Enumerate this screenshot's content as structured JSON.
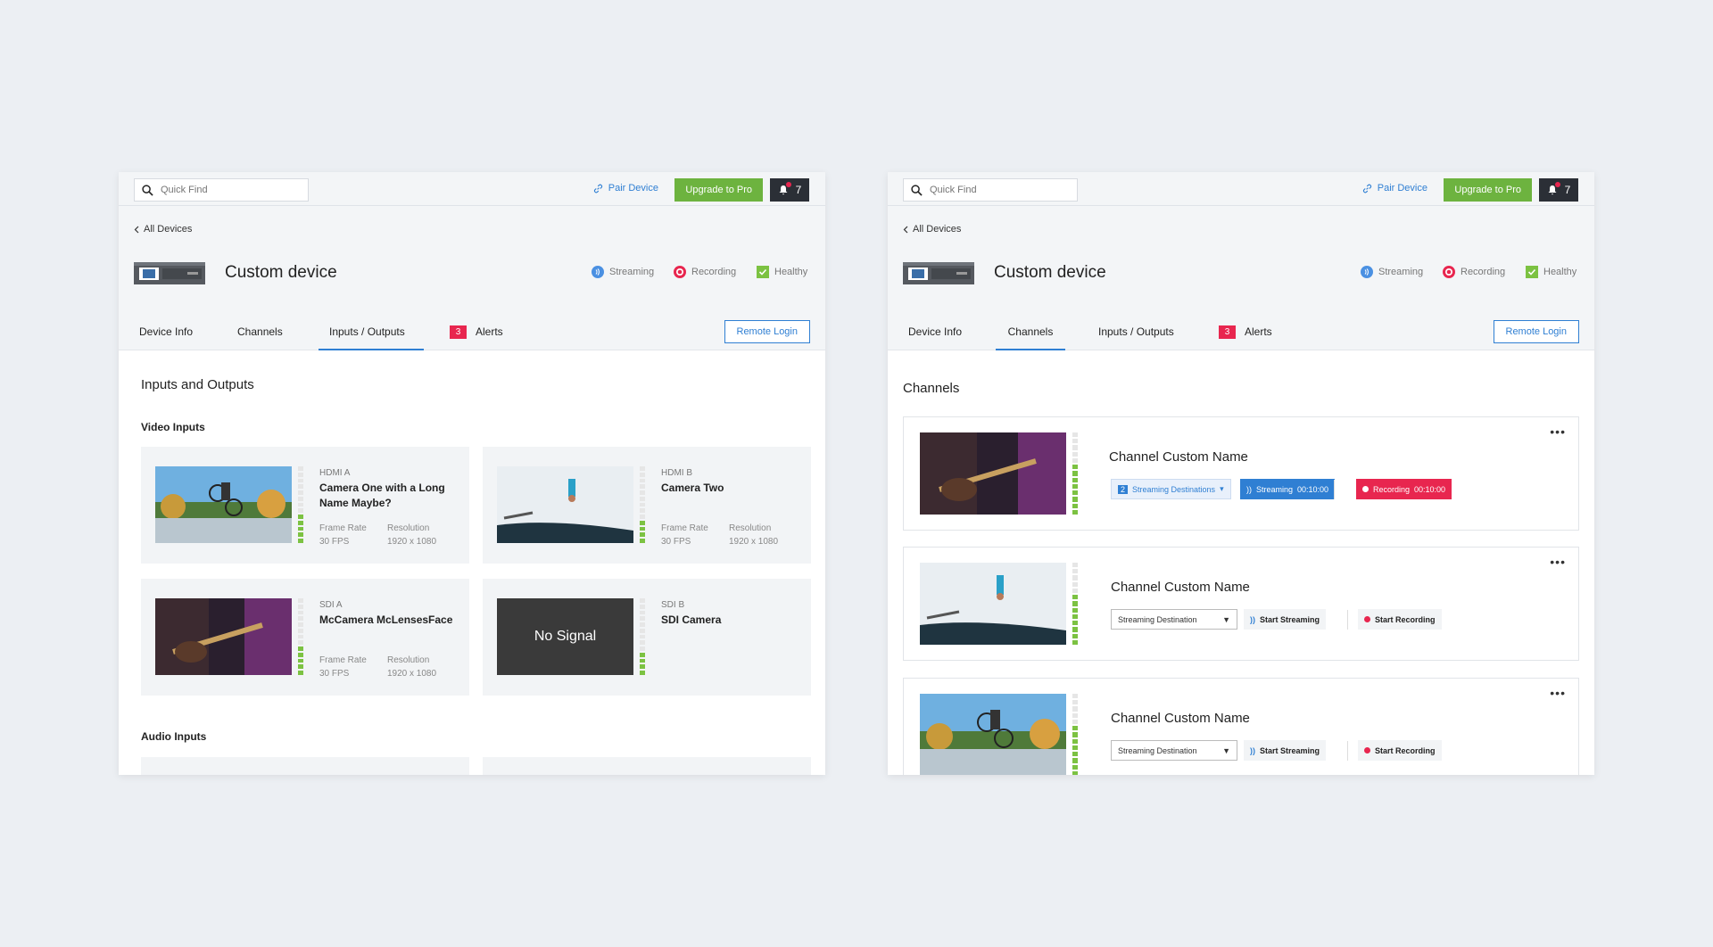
{
  "left": {
    "topbar": {
      "search_placeholder": "Quick Find",
      "pair_device": "Pair Device",
      "upgrade": "Upgrade to Pro",
      "notifications": "7"
    },
    "back": "All Devices",
    "device_name": "Custom device",
    "status": {
      "streaming": "Streaming",
      "recording": "Recording",
      "healthy": "Healthy"
    },
    "tabs": {
      "device_info": "Device Info",
      "channels": "Channels",
      "io": "Inputs / Outputs",
      "alerts_count": "3",
      "alerts": "Alerts"
    },
    "remote_login": "Remote Login",
    "section_title": "Inputs and Outputs",
    "video_inputs_label": "Video Inputs",
    "audio_inputs_label": "Audio Inputs",
    "inputs": [
      {
        "source": "HDMI A",
        "name": "Camera One with a Long Name Maybe?",
        "fr_label": "Frame Rate",
        "fr": "30 FPS",
        "res_label": "Resolution",
        "res": "1920 x 1080"
      },
      {
        "source": "HDMI B",
        "name": "Camera Two",
        "fr_label": "Frame Rate",
        "fr": "30 FPS",
        "res_label": "Resolution",
        "res": "1920 x 1080"
      },
      {
        "source": "SDI A",
        "name": "McCamera McLensesFace",
        "fr_label": "Frame Rate",
        "fr": "30 FPS",
        "res_label": "Resolution",
        "res": "1920 x 1080"
      },
      {
        "source": "SDI B",
        "name": "SDI Camera",
        "no_signal": "No Signal"
      }
    ]
  },
  "right": {
    "topbar": {
      "search_placeholder": "Quick Find",
      "pair_device": "Pair Device",
      "upgrade": "Upgrade to Pro",
      "notifications": "7"
    },
    "back": "All Devices",
    "device_name": "Custom device",
    "status": {
      "streaming": "Streaming",
      "recording": "Recording",
      "healthy": "Healthy"
    },
    "tabs": {
      "device_info": "Device Info",
      "channels": "Channels",
      "io": "Inputs / Outputs",
      "alerts_count": "3",
      "alerts": "Alerts"
    },
    "remote_login": "Remote Login",
    "section_title": "Channels",
    "channels": [
      {
        "title": "Channel Custom Name",
        "dest_count": "2",
        "dest": "Streaming Destinations",
        "streaming": "Streaming",
        "stream_time": "00:10:00",
        "recording": "Recording",
        "rec_time": "00:10:00"
      },
      {
        "title": "Channel Custom Name",
        "dest": "Streaming Destination",
        "start_stream": "Start Streaming",
        "start_rec": "Start Recording"
      },
      {
        "title": "Channel Custom Name",
        "dest": "Streaming Destination",
        "start_stream": "Start Streaming",
        "start_rec": "Start Recording"
      }
    ]
  },
  "colors": {
    "accent": "#2f7fd3",
    "upgrade": "#6db33f",
    "alert": "#e8264f",
    "meter": "#7cc242"
  }
}
